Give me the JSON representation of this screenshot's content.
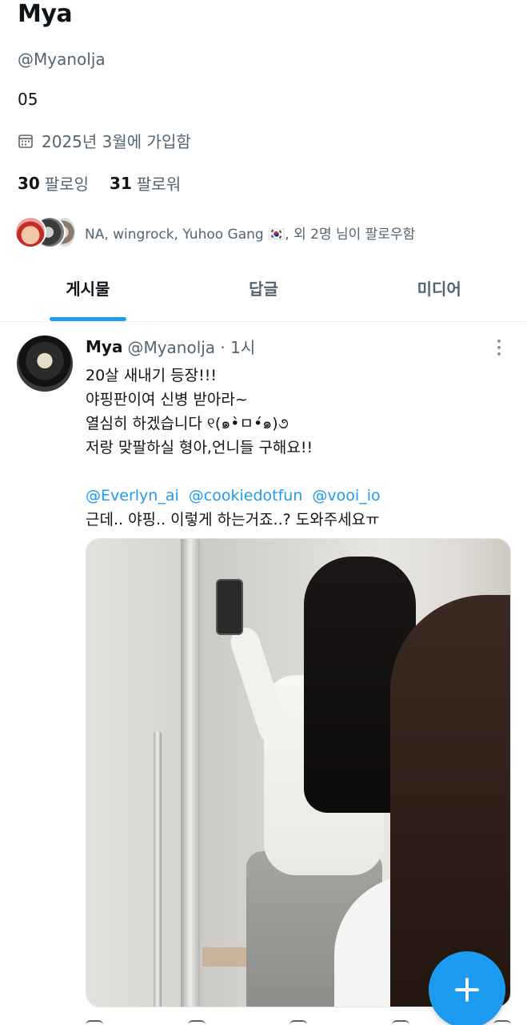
{
  "profile": {
    "display_name": "Mya",
    "handle": "@Myanolja",
    "bio": "05",
    "joined": "2025년 3월에 가입함",
    "following_count": "30",
    "following_label": "팔로잉",
    "followers_count": "31",
    "followers_label": "팔로워",
    "followed_by": "NA, wingrock, Yuhoo Gang 🇰🇷, 외 2명 님이 팔로우함"
  },
  "tabs": [
    {
      "label": "게시물"
    },
    {
      "label": "답글"
    },
    {
      "label": "미디어"
    }
  ],
  "active_tab": "게시물",
  "post": {
    "name": "Mya",
    "handle_time": "@Myanolja · 1시",
    "lines": [
      "20살 새내기 등장!!!",
      "야핑판이여 신병 받아라~",
      "열심히 하겠습니다 ୧(๑•̀ㅁ•́๑)૭",
      "저랑 맞팔하실 형아,언니들 구해요!!"
    ],
    "mentions": [
      "@Everlyn_ai",
      "@cookiedotfun",
      "@vooi_io"
    ],
    "last_line": "근데.. 야핑.. 이렇게 하는거죠..? 도와주세요ㅠ"
  },
  "colors": {
    "accent": "#1d9bf0",
    "secondary_text": "#536471"
  },
  "icons": {
    "calendar": "calendar-icon",
    "more": "more-icon",
    "compose": "plus-icon"
  }
}
